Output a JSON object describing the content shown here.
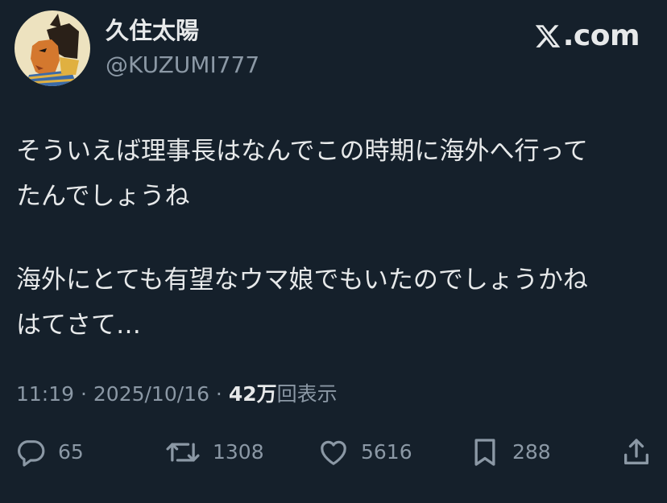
{
  "author": {
    "display_name": "久住太陽",
    "handle": "@KUZUMI777",
    "avatar_icon": "egyptian-figure-avatar"
  },
  "brand": {
    "text": ".com",
    "icon": "x-logo-icon"
  },
  "tweet": {
    "lines": [
      "そういえば理事長はなんでこの時期に海外へ行って",
      "たんでしょうね",
      "海外にとても有望なウマ娘でもいたのでしょうかね",
      "はてさて…"
    ]
  },
  "meta": {
    "time": "11:19",
    "date": "2025/10/16",
    "views_count": "42万",
    "views_label": "回表示",
    "separator": " · "
  },
  "actions": {
    "replies": "65",
    "retweets": "1308",
    "likes": "5616",
    "bookmarks": "288"
  },
  "colors": {
    "background": "#15202b",
    "text": "#e7e9ea",
    "secondary": "#8b98a5"
  }
}
